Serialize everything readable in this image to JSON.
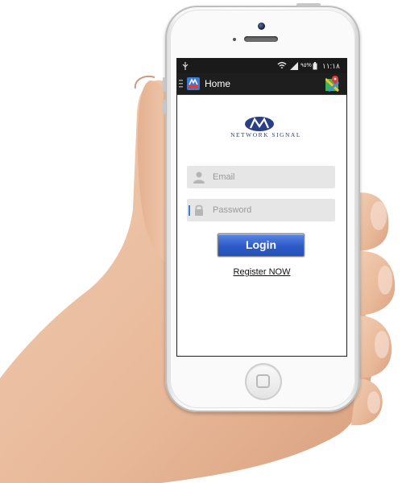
{
  "status_bar": {
    "usb_icon": "usb-icon",
    "wifi_icon": "wifi-icon",
    "signal_icon": "signal-icon",
    "battery_percent": "٩٥%",
    "time": "١١:١٨"
  },
  "action_bar": {
    "menu_icon": "menu-icon",
    "app_icon": "network-app-icon",
    "title": "Home",
    "maps_icon": "maps-icon"
  },
  "logo": {
    "text": "NETWORK SIGNAL",
    "color": "#2b3f86"
  },
  "login_form": {
    "email_placeholder": "Email",
    "password_placeholder": "Password",
    "login_label": "Login",
    "register_link": "Register NOW"
  },
  "colors": {
    "login_button": "#2d5bc7",
    "field_background": "#e6e6e6",
    "status_bar": "#1a1a1a"
  }
}
